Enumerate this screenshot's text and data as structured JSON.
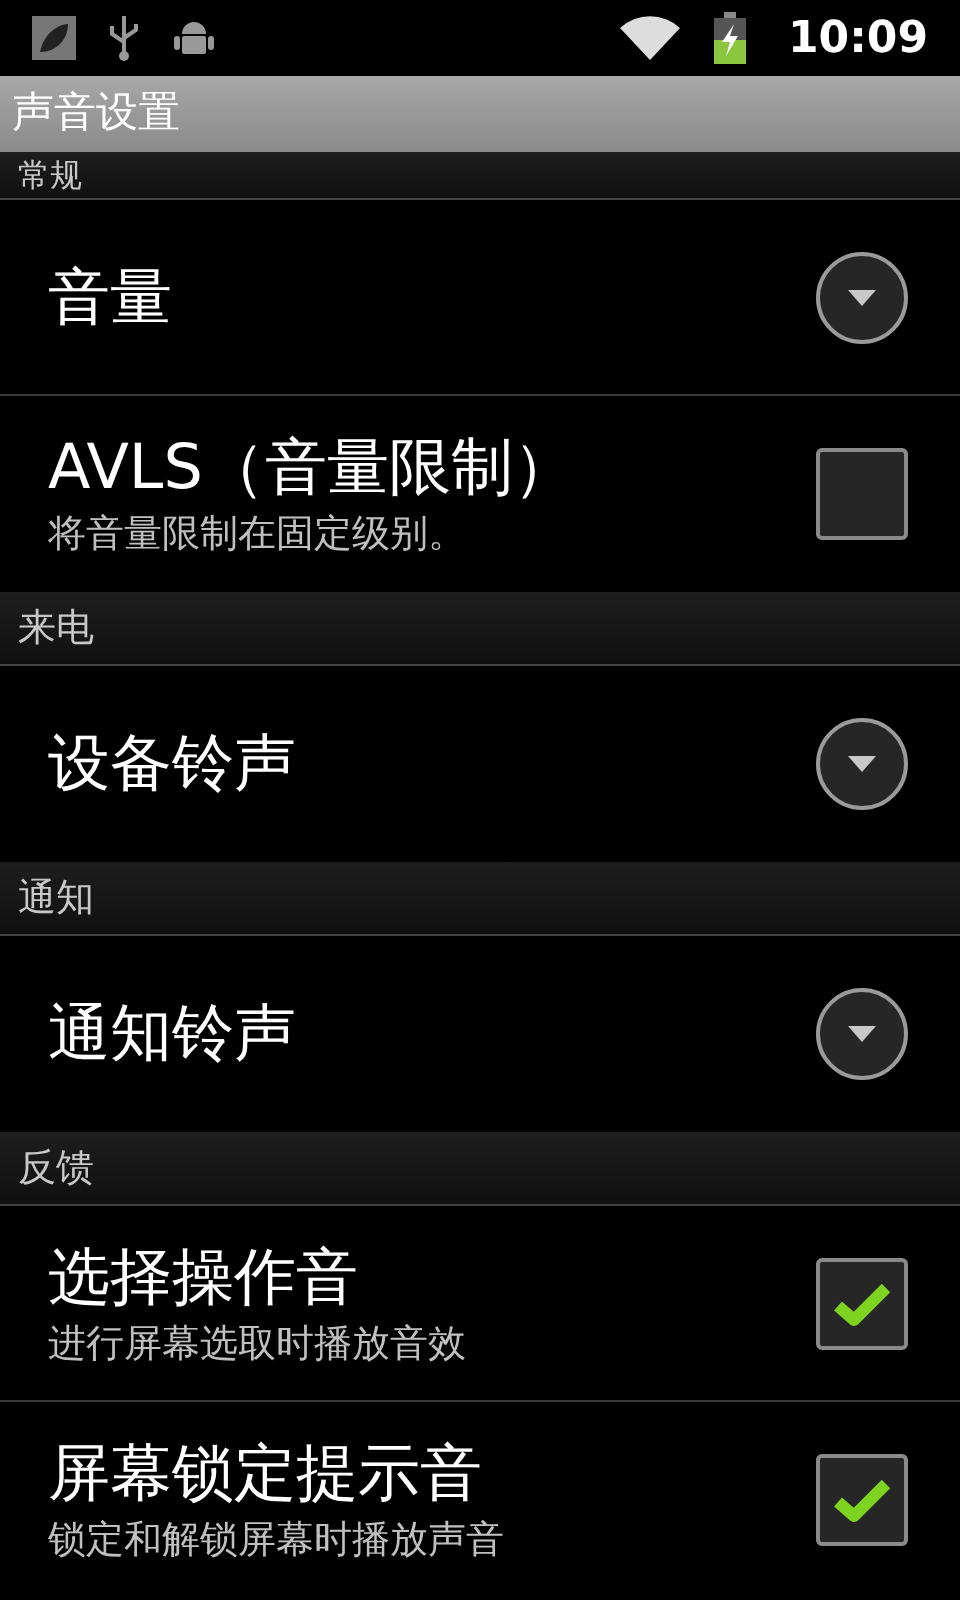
{
  "status_bar": {
    "time": "10:09"
  },
  "title": "声音设置",
  "sections": [
    {
      "header": "常规",
      "items": [
        {
          "kind": "dropdown",
          "title": "音量"
        },
        {
          "kind": "checkbox",
          "title": "AVLS（音量限制）",
          "summary": "将音量限制在固定级别。",
          "checked": false
        }
      ]
    },
    {
      "header": "来电",
      "items": [
        {
          "kind": "dropdown",
          "title": "设备铃声"
        }
      ]
    },
    {
      "header": "通知",
      "items": [
        {
          "kind": "dropdown",
          "title": "通知铃声"
        }
      ]
    },
    {
      "header": "反馈",
      "items": [
        {
          "kind": "checkbox",
          "title": "选择操作音",
          "summary": "进行屏幕选取时播放音效",
          "checked": true
        },
        {
          "kind": "checkbox",
          "title": "屏幕锁定提示音",
          "summary": "锁定和解锁屏幕时播放声音",
          "checked": true
        }
      ]
    }
  ]
}
